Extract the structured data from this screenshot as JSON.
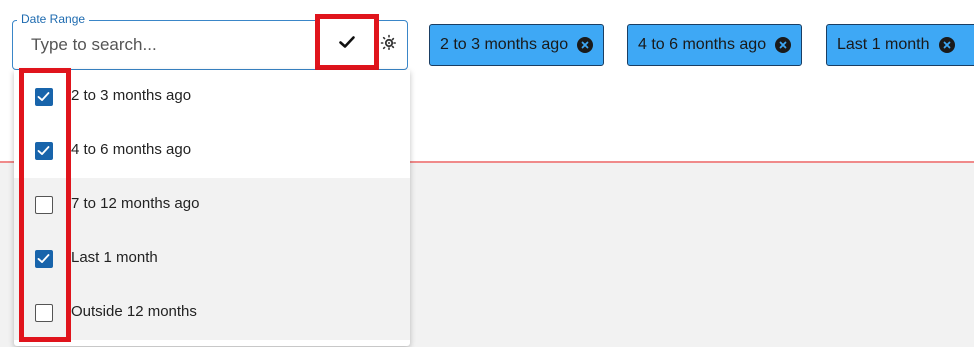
{
  "field": {
    "legend": "Date Range",
    "placeholder": "Type to search..."
  },
  "chips": [
    {
      "label": "2 to 3 months ago"
    },
    {
      "label": "4 to 6 months ago"
    },
    {
      "label": "Last 1 month"
    }
  ],
  "options": [
    {
      "label": "2 to 3 months ago",
      "checked": true
    },
    {
      "label": "4 to 6 months ago",
      "checked": true
    },
    {
      "label": "7 to 12 months ago",
      "checked": false
    },
    {
      "label": "Last 1 month",
      "checked": true
    },
    {
      "label": "Outside 12 months",
      "checked": false
    }
  ],
  "icons": {
    "confirm": "check-icon",
    "settings": "settings-icon",
    "chip_remove": "close-circle-icon"
  },
  "colors": {
    "accent": "#1864ab",
    "chip": "#3ea8f5",
    "highlight": "#e0141c"
  }
}
